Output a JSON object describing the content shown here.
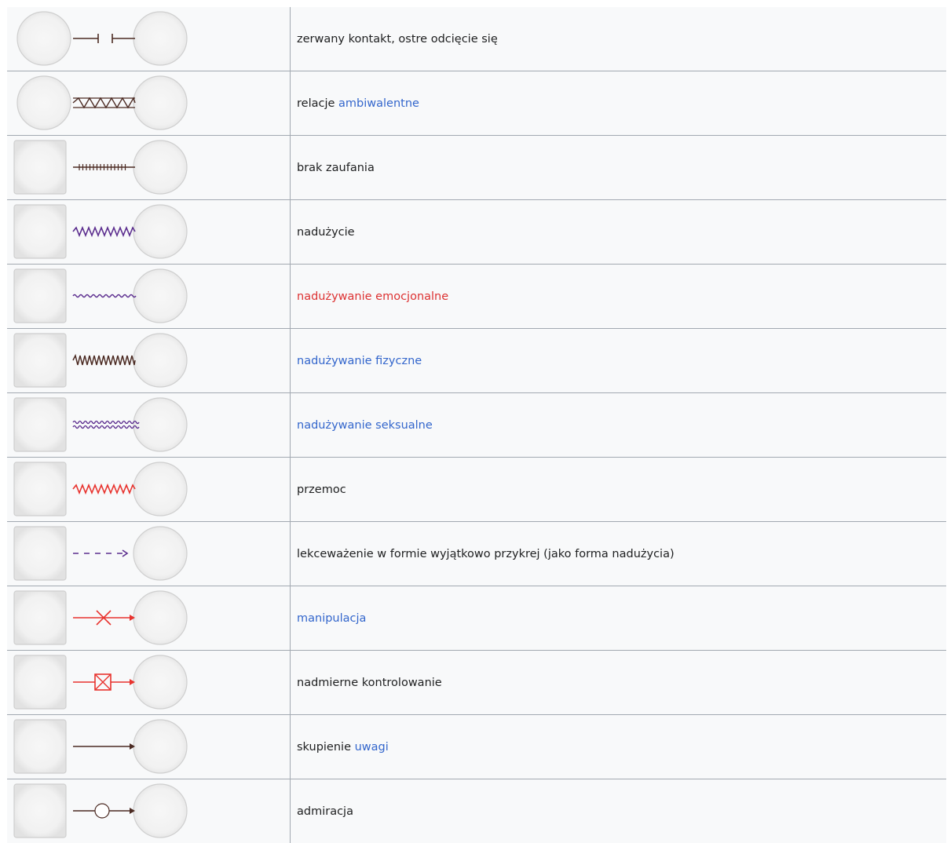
{
  "rows": [
    {
      "left": "circle",
      "rel": "cutoff",
      "parts": [
        {
          "text": "zerwany kontakt, ostre odcięcie się",
          "kind": "text"
        }
      ]
    },
    {
      "left": "circle",
      "rel": "ambivalent",
      "parts": [
        {
          "text": "relacje ",
          "kind": "text"
        },
        {
          "text": "ambiwalentne",
          "kind": "link"
        }
      ]
    },
    {
      "left": "square",
      "rel": "distrust",
      "parts": [
        {
          "text": "brak zaufania",
          "kind": "text"
        }
      ]
    },
    {
      "left": "square",
      "rel": "abuse",
      "parts": [
        {
          "text": "nadużycie",
          "kind": "text"
        }
      ]
    },
    {
      "left": "square",
      "rel": "emotional",
      "parts": [
        {
          "text": "nadużywanie emocjonalne",
          "kind": "redlink"
        }
      ]
    },
    {
      "left": "square",
      "rel": "physical",
      "parts": [
        {
          "text": "nadużywanie fizyczne",
          "kind": "link"
        }
      ]
    },
    {
      "left": "square",
      "rel": "sexual",
      "parts": [
        {
          "text": "nadużywanie seksualne",
          "kind": "link"
        }
      ]
    },
    {
      "left": "square",
      "rel": "violence",
      "parts": [
        {
          "text": "przemoc",
          "kind": "text"
        }
      ]
    },
    {
      "left": "square",
      "rel": "neglect",
      "parts": [
        {
          "text": "lekceważenie w formie wyjątkowo przykrej (jako forma nadużycia)",
          "kind": "text"
        }
      ]
    },
    {
      "left": "square",
      "rel": "manipulation",
      "parts": [
        {
          "text": "manipulacja",
          "kind": "link"
        }
      ]
    },
    {
      "left": "square",
      "rel": "controlling",
      "parts": [
        {
          "text": "nadmierne kontrolowanie",
          "kind": "text"
        }
      ]
    },
    {
      "left": "square",
      "rel": "focus",
      "parts": [
        {
          "text": "skupienie ",
          "kind": "text"
        },
        {
          "text": "uwagi",
          "kind": "link"
        }
      ]
    },
    {
      "left": "square",
      "rel": "admiration",
      "parts": [
        {
          "text": "admiracja",
          "kind": "text"
        }
      ]
    }
  ],
  "colors": {
    "brown": "#4b2a22",
    "purple": "#5b2d8e",
    "red": "#e8332e",
    "link": "#3366cc",
    "redlink": "#dd3333"
  }
}
